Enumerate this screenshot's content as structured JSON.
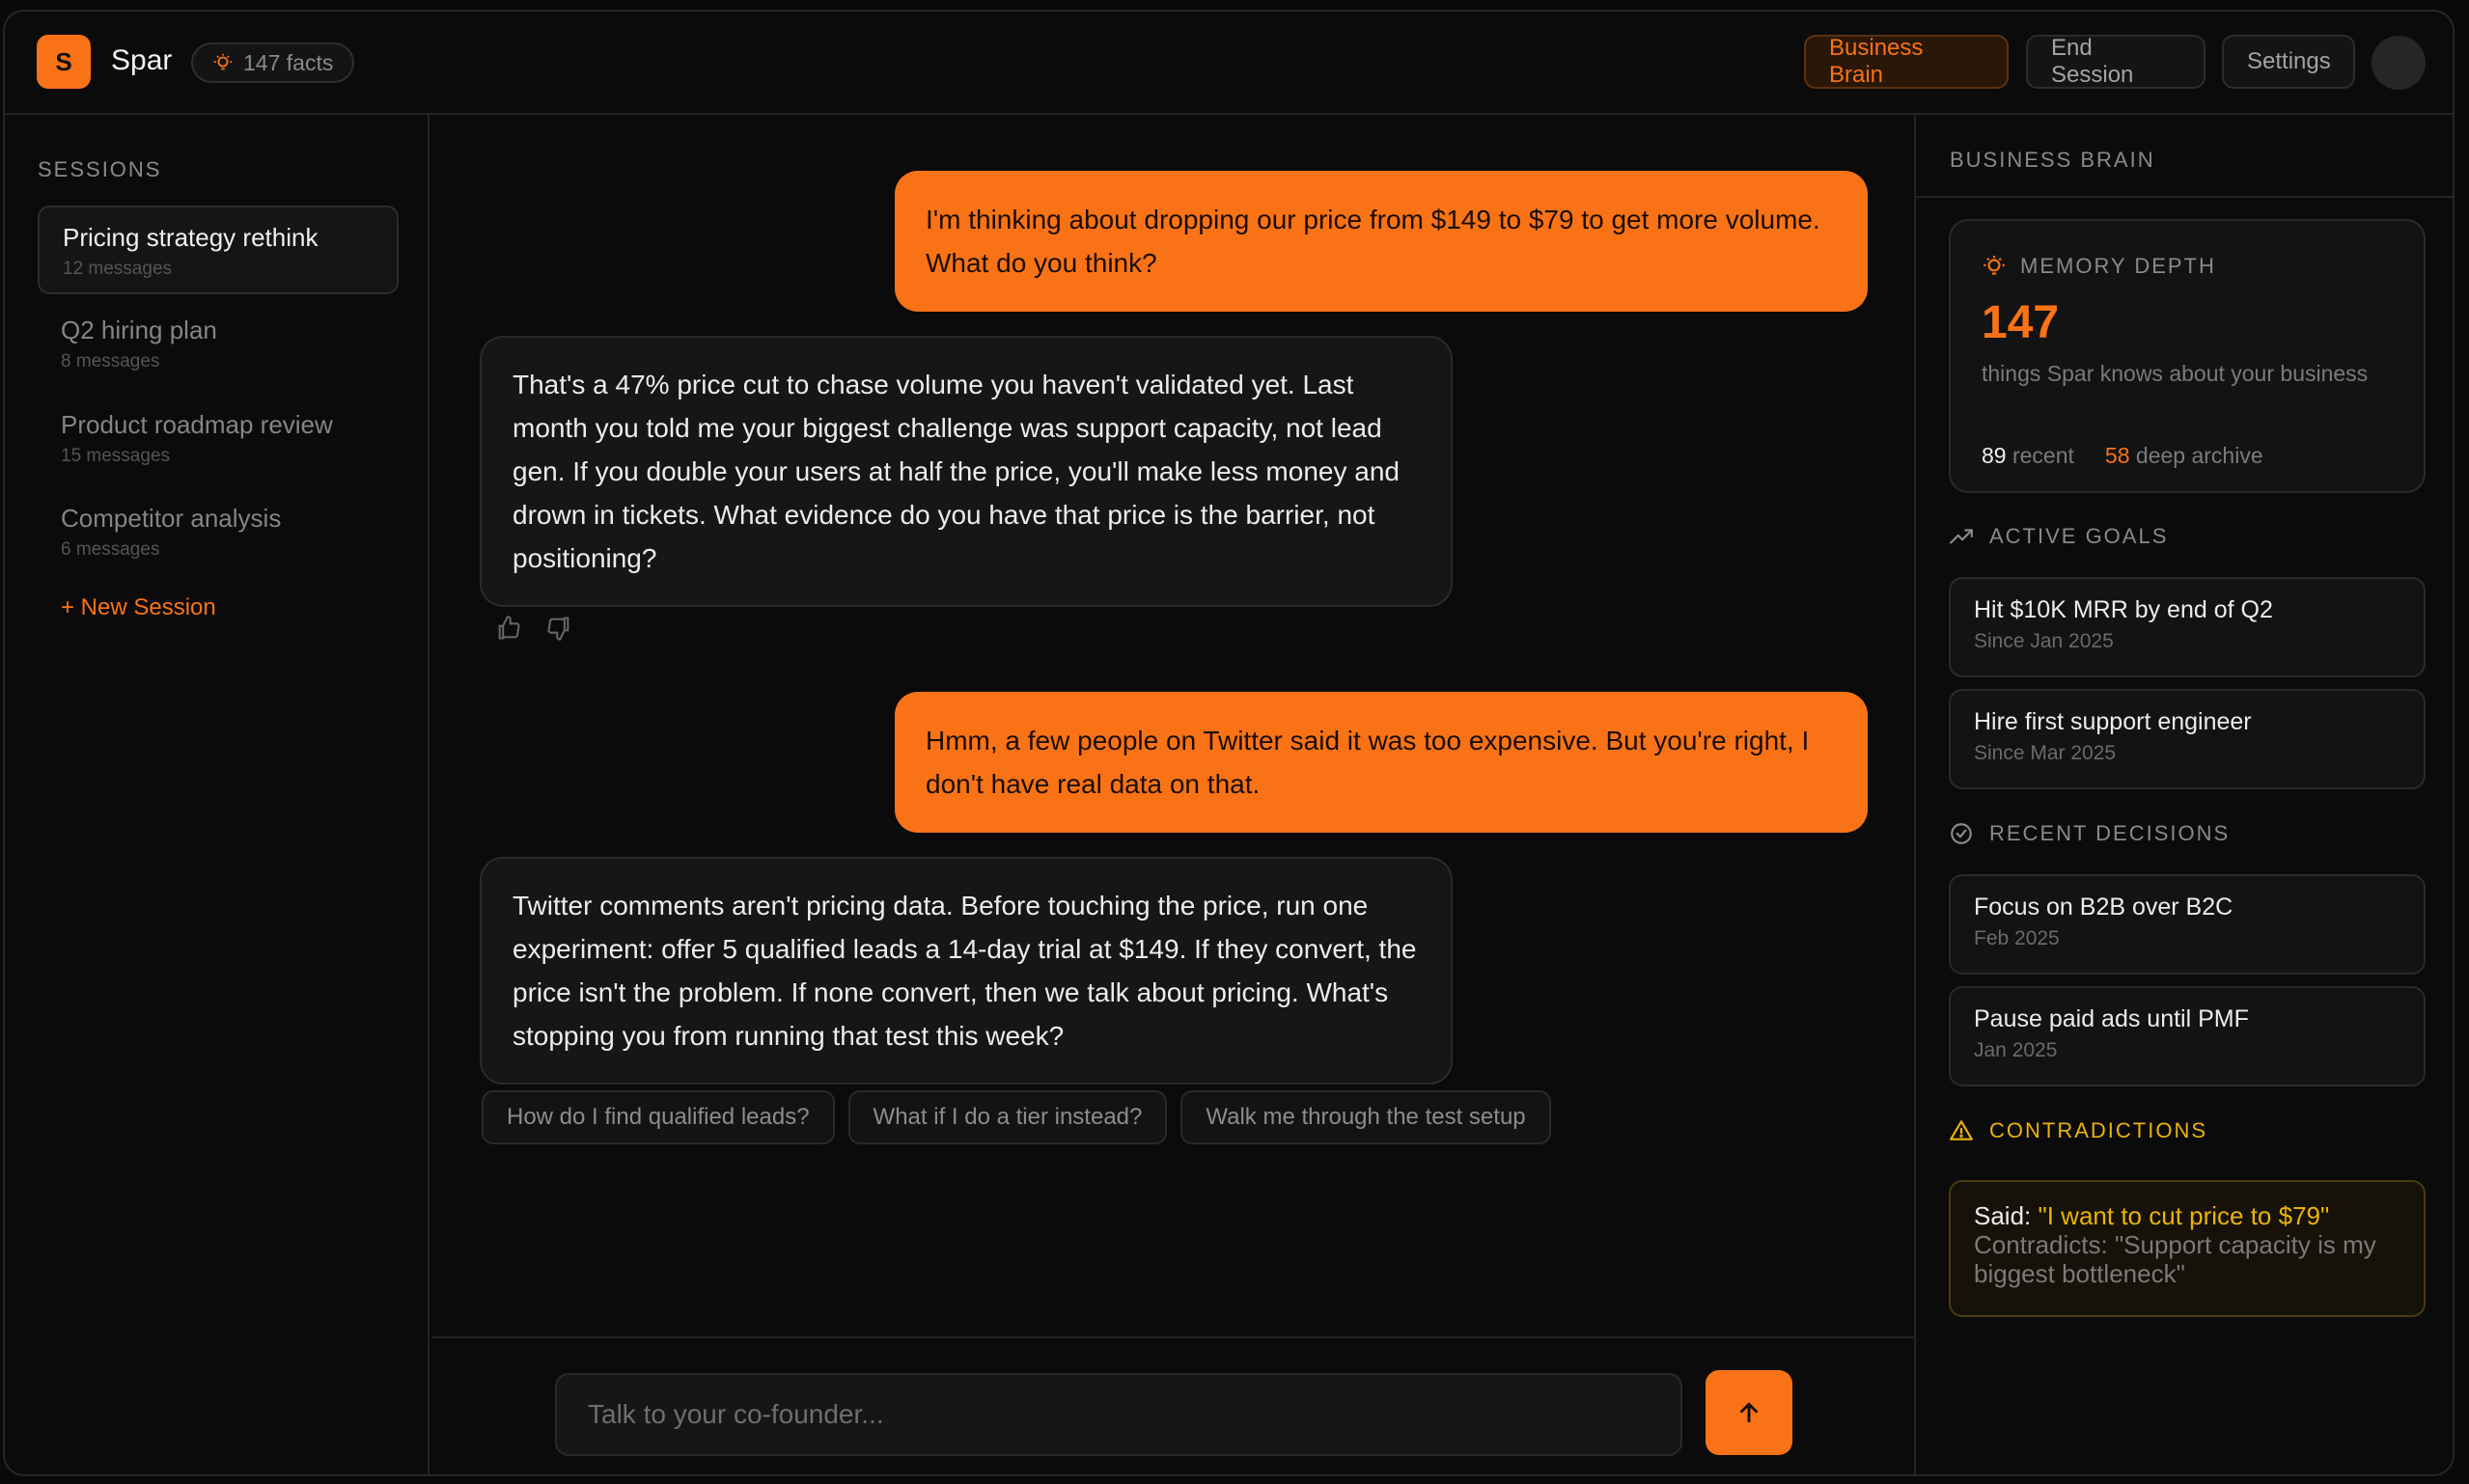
{
  "header": {
    "logo_letter": "S",
    "app_name": "Spar",
    "facts_pill": "147 facts",
    "buttons": {
      "business_brain": "Business Brain",
      "end_session": "End Session",
      "settings": "Settings"
    }
  },
  "sidebar": {
    "title": "SESSIONS",
    "sessions": [
      {
        "title": "Pricing strategy rethink",
        "meta": "12 messages",
        "active": true
      },
      {
        "title": "Q2 hiring plan",
        "meta": "8 messages",
        "active": false
      },
      {
        "title": "Product roadmap review",
        "meta": "15 messages",
        "active": false
      },
      {
        "title": "Competitor analysis",
        "meta": "6 messages",
        "active": false
      }
    ],
    "new_session": "+ New Session"
  },
  "chat": {
    "messages": [
      {
        "role": "user",
        "text": "I'm thinking about dropping our price from $149 to $79 to get more volume. What do you think?"
      },
      {
        "role": "assistant",
        "text": "That's a 47% price cut to chase volume you haven't validated yet. Last month you told me your biggest challenge was support capacity, not lead gen. If you double your users at half the price, you'll make less money and drown in tickets. What evidence do you have that price is the barrier, not positioning?"
      },
      {
        "role": "user",
        "text": "Hmm, a few people on Twitter said it was too expensive. But you're right, I don't have real data on that."
      },
      {
        "role": "assistant",
        "text": "Twitter comments aren't pricing data. Before touching the price, run one experiment: offer 5 qualified leads a 14-day trial at $149. If they convert, the price isn't the problem. If none convert, then we talk about pricing. What's stopping you from running that test this week?"
      }
    ],
    "suggestions": [
      "How do I find qualified leads?",
      "What if I do a tier instead?",
      "Walk me through the test setup"
    ],
    "input_placeholder": "Talk to your co-founder..."
  },
  "brain": {
    "title": "BUSINESS BRAIN",
    "memory": {
      "label": "MEMORY DEPTH",
      "count": "147",
      "description": "things Spar knows about your business",
      "recent_count": "89",
      "recent_label": "recent",
      "archive_count": "58",
      "archive_label": "deep archive"
    },
    "goals_label": "ACTIVE GOALS",
    "goals": [
      {
        "title": "Hit $10K MRR by end of Q2",
        "meta": "Since Jan 2025"
      },
      {
        "title": "Hire first support engineer",
        "meta": "Since Mar 2025"
      }
    ],
    "decisions_label": "RECENT DECISIONS",
    "decisions": [
      {
        "title": "Focus on B2B over B2C",
        "meta": "Feb 2025"
      },
      {
        "title": "Pause paid ads until PMF",
        "meta": "Jan 2025"
      }
    ],
    "contradictions_label": "CONTRADICTIONS",
    "contradiction": {
      "said_label": "Said:",
      "said_quote": "\"I want to cut price to $79\"",
      "contradicts": "Contradicts: \"Support capacity is my biggest bottleneck\""
    }
  },
  "colors": {
    "accent": "#f97316",
    "warning": "#eab308",
    "background": "#0b0b0b"
  }
}
